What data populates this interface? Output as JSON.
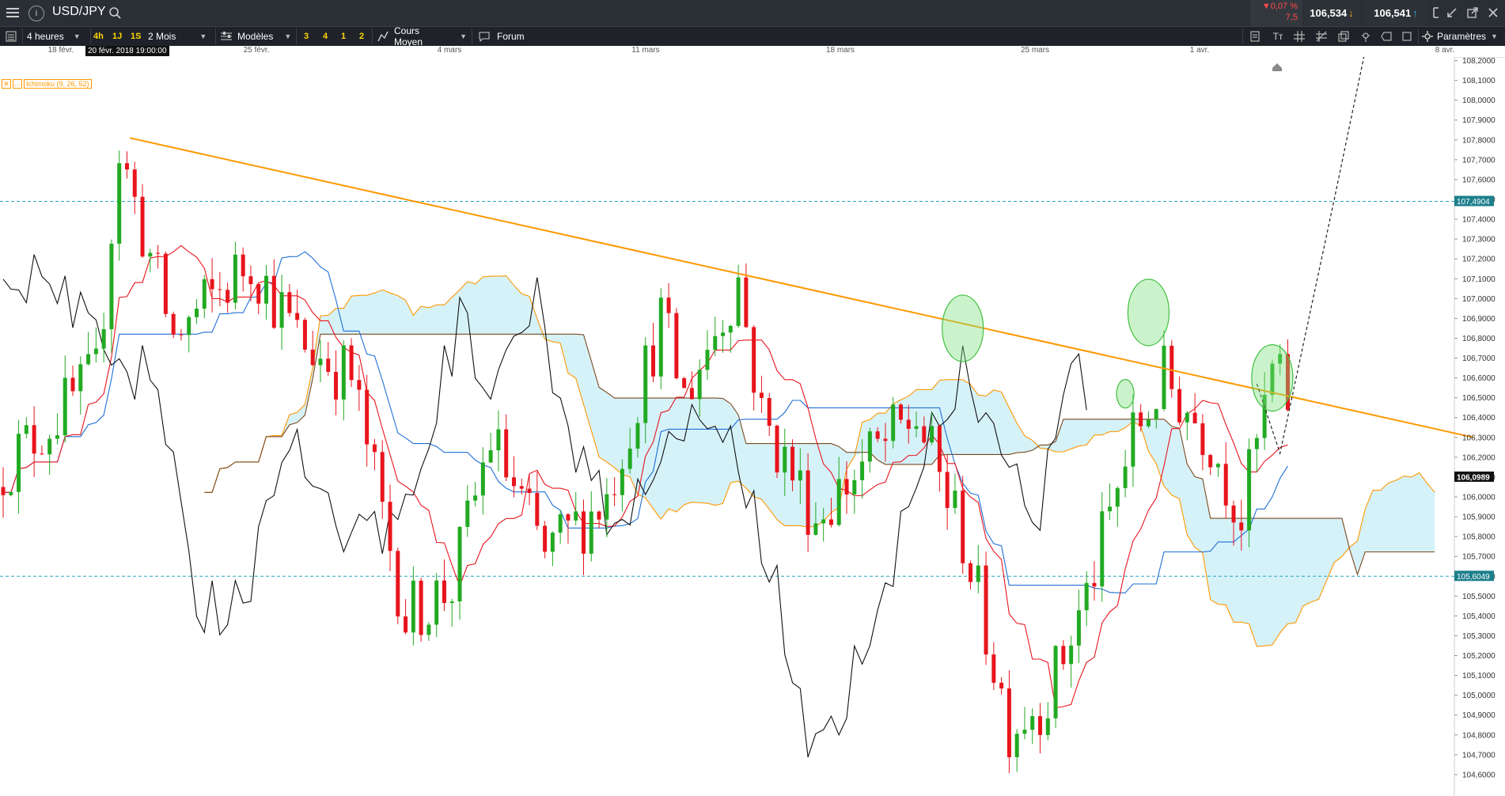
{
  "header": {
    "symbol": "USD/JPY",
    "change_pct": "▼0,07 %",
    "change_val": "7,5",
    "bid": "106,534",
    "ask": "106,541"
  },
  "toolbar": {
    "timeframe": "4 heures",
    "quick_1": "4h",
    "quick_2": "1J",
    "quick_3": "1S",
    "range": "2 Mois",
    "templates": "Modèles",
    "layout_1": "3",
    "layout_2": "4",
    "layout_3": "1",
    "layout_4": "2",
    "price_type": "Cours Moyen",
    "forum": "Forum",
    "settings": "Paramètres"
  },
  "colors": {
    "up": "#22aa22",
    "down": "#e8141c",
    "trend": "#ff9800",
    "tenkan": "#e8141c",
    "kijun": "#1f6fd6",
    "chikou": "#111111",
    "spanA": "#ff9800",
    "spanB": "#7a4a1e",
    "cloud": "#c8eef7"
  },
  "chart_data": {
    "type": "candlestick",
    "symbol": "USD/JPY",
    "interval": "4 heures",
    "x_labels": [
      "18 févr.",
      "25 févr.",
      "4 mars",
      "11 mars",
      "18 mars",
      "25 mars",
      "1 avr.",
      "8 avr."
    ],
    "crosshair_label": "20 févr. 2018 19:00:00",
    "indicator_label": "Ichimoku (9, 26, 52)",
    "ylim": [
      104.5,
      108.25
    ],
    "y_ticks": [
      "104,6000",
      "104,7000",
      "104,8000",
      "104,9000",
      "105,0000",
      "105,1000",
      "105,2000",
      "105,3000",
      "105,4000",
      "105,5000",
      "105,6000",
      "105,7000",
      "105,8000",
      "105,9000",
      "106,0000",
      "106,1000",
      "106,2000",
      "106,3000",
      "106,4000",
      "106,5000",
      "106,6000",
      "106,7000",
      "106,8000",
      "106,9000",
      "107,0000",
      "107,1000",
      "107,2000",
      "107,3000",
      "107,4000",
      "107,5000",
      "107,6000",
      "107,7000",
      "107,8000",
      "107,9000",
      "108,0000",
      "108,1000",
      "108,2000"
    ],
    "h_levels": [
      {
        "value": 107.49,
        "label": "107,4904"
      },
      {
        "value": 105.6,
        "label": "105,6049"
      }
    ],
    "last_price": {
      "value": 106.1,
      "label": "106,0989"
    },
    "trendline": {
      "from": {
        "bar": 0,
        "value": 107.81
      },
      "to": {
        "bar": 190,
        "value": 106.3
      }
    },
    "projection": [
      {
        "bar": 162,
        "value": 106.57
      },
      {
        "bar": 165,
        "value": 106.22
      },
      {
        "bar": 172,
        "value": 107.5
      },
      {
        "bar": 176,
        "value": 108.25
      }
    ],
    "circles": [
      {
        "bar": 124,
        "value": 106.85
      },
      {
        "bar": 145,
        "value": 106.52
      },
      {
        "bar": 148,
        "value": 106.93
      },
      {
        "bar": 164,
        "value": 106.6
      }
    ],
    "candles_seed": {
      "count": 167,
      "start_price": 106.05
    }
  }
}
